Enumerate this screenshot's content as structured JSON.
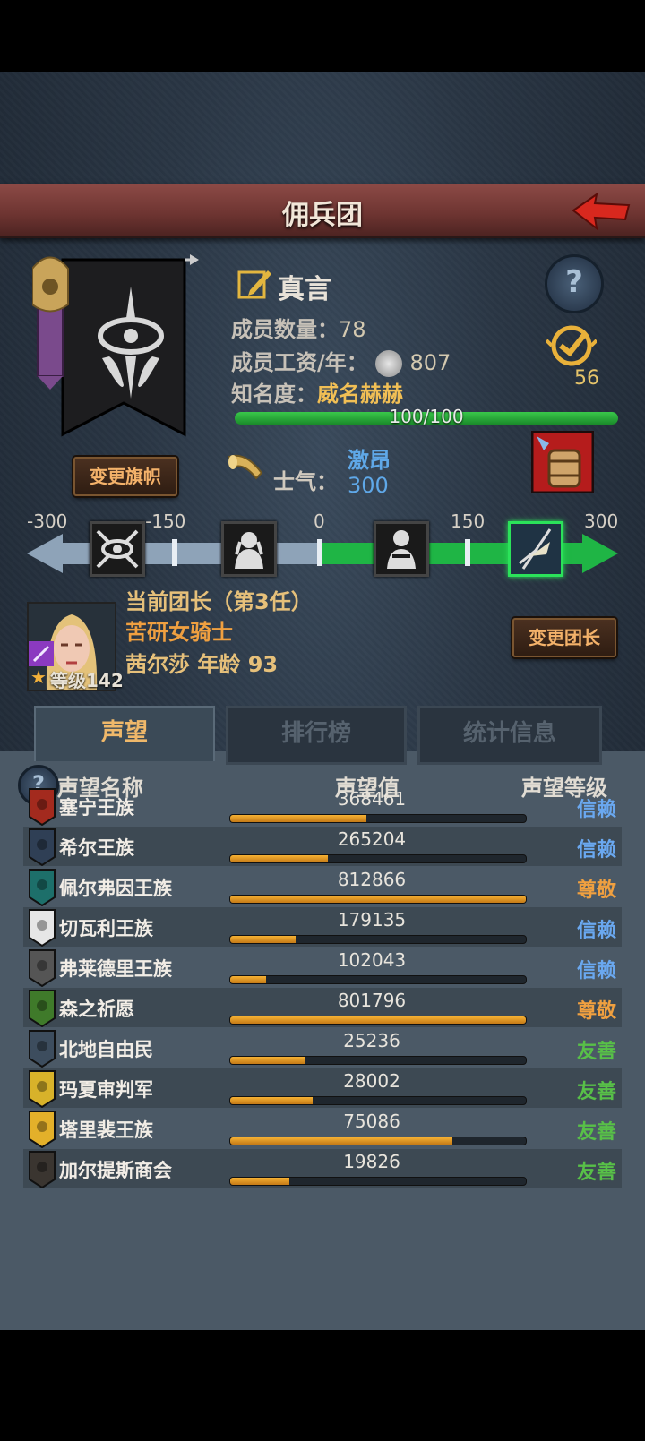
{
  "header": {
    "title": "佣兵团"
  },
  "company": {
    "motto": "真言",
    "members_label": "成员数量：",
    "members_value": "78",
    "wage_label": "成员工资/年：",
    "wage_value": "807",
    "fame_label": "知名度：",
    "fame_value": "威名赫赫",
    "fame_progress_text": "100/100",
    "fame_progress": 1.0,
    "change_flag_label": "变更旗帜",
    "rank_badge": "56"
  },
  "morale": {
    "label": "士气：",
    "state": "激昂",
    "value": "300",
    "scale_labels": [
      "-300",
      "-150",
      "0",
      "150",
      "300"
    ]
  },
  "leader": {
    "title": "当前团长（第3任）",
    "class": "苦研女骑士",
    "name_age": "茜尔莎 年龄 93",
    "level_text": "等级142",
    "change_leader_label": "变更团长"
  },
  "tabs": [
    "声望",
    "排行榜",
    "统计信息"
  ],
  "reputation": {
    "headers": {
      "name": "声望名称",
      "value": "声望值",
      "level": "声望等级"
    },
    "rows": [
      {
        "name": "塞宁王族",
        "value": "368461",
        "fill": 0.46,
        "level": "信赖",
        "level_color": "#6aa8f0",
        "crest_color": "#a32a1e"
      },
      {
        "name": "希尔王族",
        "value": "265204",
        "fill": 0.33,
        "level": "信赖",
        "level_color": "#6aa8f0",
        "crest_color": "#2f3f55"
      },
      {
        "name": "佩尔弗因王族",
        "value": "812866",
        "fill": 1.0,
        "level": "尊敬",
        "level_color": "#f0a040",
        "crest_color": "#1d6f6a"
      },
      {
        "name": "切瓦利王族",
        "value": "179135",
        "fill": 0.22,
        "level": "信赖",
        "level_color": "#6aa8f0",
        "crest_color": "#e6e6e6"
      },
      {
        "name": "弗莱德里王族",
        "value": "102043",
        "fill": 0.12,
        "level": "信赖",
        "level_color": "#6aa8f0",
        "crest_color": "#555555"
      },
      {
        "name": "森之祈愿",
        "value": "801796",
        "fill": 1.0,
        "level": "尊敬",
        "level_color": "#f0a040",
        "crest_color": "#3f7a2a"
      },
      {
        "name": "北地自由民",
        "value": "25236",
        "fill": 0.25,
        "level": "友善",
        "level_color": "#58c048",
        "crest_color": "#3d4d5e"
      },
      {
        "name": "玛夏审判军",
        "value": "28002",
        "fill": 0.28,
        "level": "友善",
        "level_color": "#58c048",
        "crest_color": "#d8b22a"
      },
      {
        "name": "塔里裴王族",
        "value": "75086",
        "fill": 0.75,
        "level": "友善",
        "level_color": "#58c048",
        "crest_color": "#e3b02a"
      },
      {
        "name": "加尔提斯商会",
        "value": "19826",
        "fill": 0.2,
        "level": "友善",
        "level_color": "#58c048",
        "crest_color": "#3a3530"
      }
    ]
  }
}
